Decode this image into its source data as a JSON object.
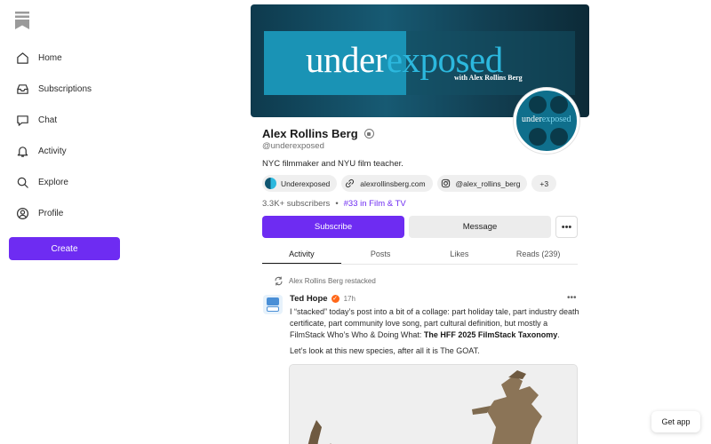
{
  "sidebar": {
    "items": [
      {
        "label": "Home",
        "icon": "home-icon"
      },
      {
        "label": "Subscriptions",
        "icon": "inbox-icon"
      },
      {
        "label": "Chat",
        "icon": "chat-icon"
      },
      {
        "label": "Activity",
        "icon": "bell-icon"
      },
      {
        "label": "Explore",
        "icon": "search-icon"
      },
      {
        "label": "Profile",
        "icon": "user-icon"
      }
    ],
    "create_label": "Create"
  },
  "banner": {
    "title_part1": "under",
    "title_part2": "exposed",
    "subtitle": "with Alex Rollins Berg",
    "avatar_text1": "under",
    "avatar_text2": "exposed"
  },
  "profile": {
    "name": "Alex Rollins Berg",
    "handle": "@underexposed",
    "bio": "NYC filmmaker and NYU film teacher.",
    "chips": {
      "publication": "Underexposed",
      "website": "alexrollinsberg.com",
      "instagram": "@alex_rollins_berg",
      "more": "+3"
    },
    "subscribers": "3.3K+ subscribers",
    "separator": "•",
    "rank": "#33 in Film & TV",
    "subscribe_label": "Subscribe",
    "message_label": "Message",
    "more_label": "•••"
  },
  "tabs": [
    "Activity",
    "Posts",
    "Likes",
    "Reads (239)"
  ],
  "post": {
    "restack_text": "Alex Rollins Berg restacked",
    "author": "Ted Hope",
    "time": "17h",
    "more": "•••",
    "body_text": "I “stacked” today’s post into a bit of a collage: part holiday tale, part industry death certificate, part community love song, part cultural definition, but mostly a FilmStack Who’s Who & Doing What: ",
    "body_bold": "The HFF 2025 FilmStack Taxonomy",
    "body_end": ".",
    "line2": "Let’s look at this new species, after all it is The GOAT."
  },
  "get_app_label": "Get app",
  "colors": {
    "accent": "#6e2cf2",
    "verified": "#ff6719"
  }
}
